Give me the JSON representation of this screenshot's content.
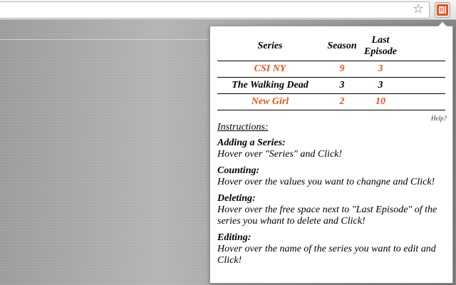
{
  "popup": {
    "table": {
      "headers": {
        "series": "Series",
        "season": "Season",
        "last_episode_1": "Last",
        "last_episode_2": "Episode"
      },
      "rows": [
        {
          "series": "CSI NY",
          "season": "9",
          "last_episode": "3",
          "highlight": true
        },
        {
          "series": "The Walking Dead",
          "season": "3",
          "last_episode": "3",
          "highlight": false
        },
        {
          "series": "New Girl",
          "season": "2",
          "last_episode": "10",
          "highlight": true
        }
      ]
    },
    "help_label": "Help?",
    "instructions": {
      "heading": "Instructions:",
      "items": [
        {
          "title": "Adding a Series:",
          "text": "Hover over \"Series\" and Click!"
        },
        {
          "title": "Counting:",
          "text": "Hover over the values you want to changne and Click!"
        },
        {
          "title": "Deleting:",
          "text": "Hover over the free space next to \"Last Episode\" of the series you whant to delete and Click!"
        },
        {
          "title": "Editing:",
          "text": "Hover over the name of the series you want to edit and Click!"
        }
      ]
    }
  },
  "toolbar": {
    "star_icon": "star-icon",
    "extension_icon": "series-tracker-icon"
  },
  "colors": {
    "accent": "#e8541c"
  }
}
